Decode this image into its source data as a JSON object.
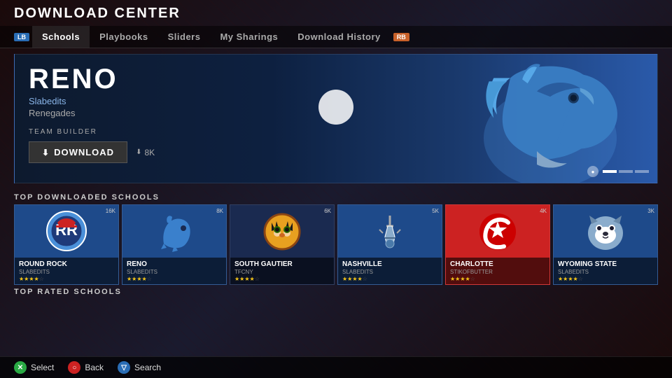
{
  "header": {
    "title": "DOWNLOAD CENTER"
  },
  "nav": {
    "left_badge": "LB",
    "right_badge": "RB",
    "items": [
      {
        "label": "Schools",
        "active": true
      },
      {
        "label": "Playbooks",
        "active": false
      },
      {
        "label": "Sliders",
        "active": false
      },
      {
        "label": "My Sharings",
        "active": false
      },
      {
        "label": "Download History",
        "active": false
      }
    ]
  },
  "featured": {
    "team_name": "RENO",
    "author": "Slabedits",
    "team_nickname": "Renegades",
    "category_label": "TEAM BUILDER",
    "download_label": "DOWNLOAD",
    "download_count": "8K"
  },
  "top_downloaded": {
    "section_label": "TOP DOWNLOADED SCHOOLS",
    "schools": [
      {
        "name": "ROUND ROCK",
        "author": "SLABEDITS",
        "count": "16K",
        "stars": 4.5,
        "color": "#1e4a8a"
      },
      {
        "name": "RENO",
        "author": "SLABEDITS",
        "count": "8K",
        "stars": 4.0,
        "color": "#1e4a8a"
      },
      {
        "name": "SOUTH GAUTIER",
        "author": "TFCNY",
        "count": "6K",
        "stars": 4.0,
        "color": "#1e3a6a"
      },
      {
        "name": "NASHVILLE",
        "author": "SLABEDITS",
        "count": "5K",
        "stars": 4.0,
        "color": "#1e4a8a"
      },
      {
        "name": "CHARLOTTE",
        "author": "STIKOFBUTTER",
        "count": "4K",
        "stars": 4.5,
        "color": "#cc2222"
      },
      {
        "name": "WYOMING STATE",
        "author": "SLABEDITS",
        "count": "3K",
        "stars": 4.0,
        "color": "#1e4a8a"
      }
    ]
  },
  "top_rated": {
    "section_label": "TOP RATED SCHOOLS"
  },
  "bottom_nav": {
    "select_label": "Select",
    "back_label": "Back",
    "search_label": "Search"
  }
}
